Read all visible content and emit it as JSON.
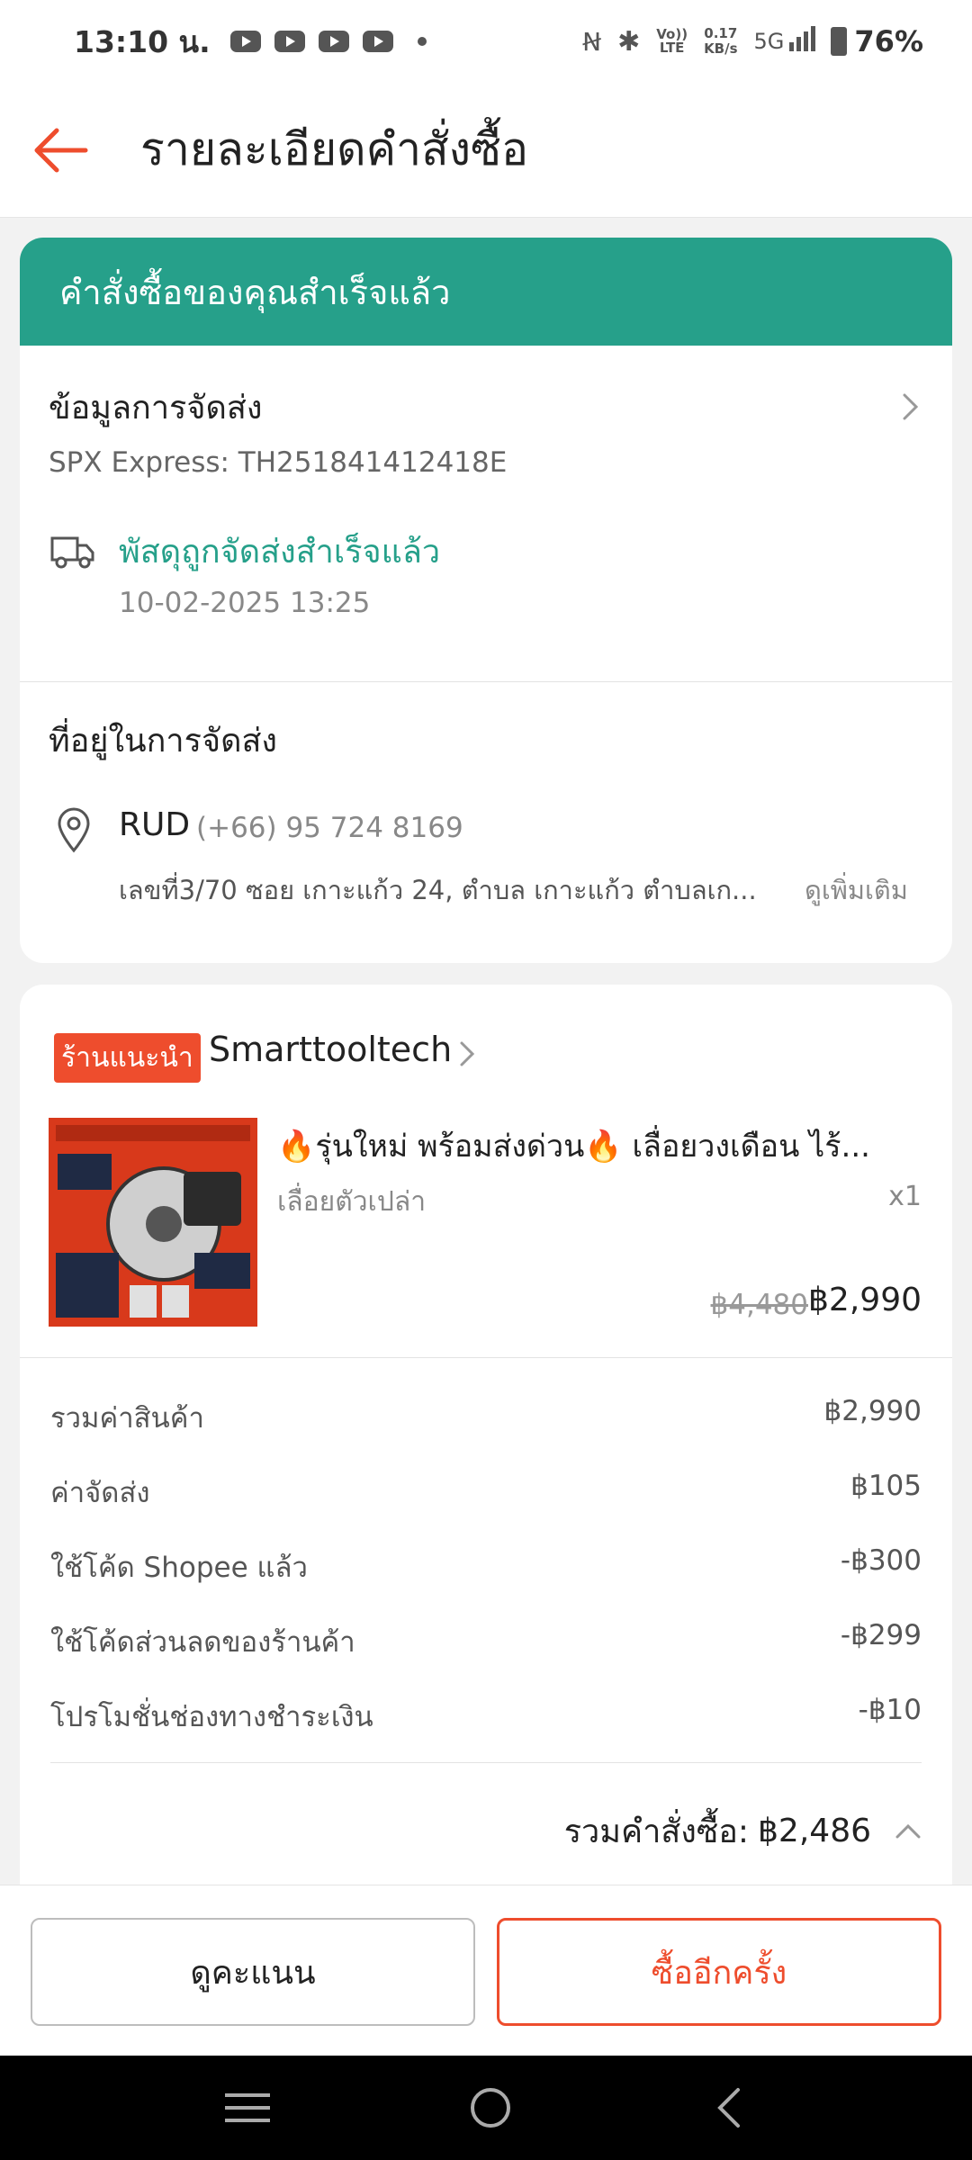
{
  "status_bar": {
    "time": "13:10 น.",
    "network_speed_top": "0.17",
    "network_speed_unit": "KB/s",
    "network_type": "5G",
    "battery": "76%"
  },
  "header": {
    "title": "รายละเอียดคำสั่งซื้อ"
  },
  "order_status": {
    "banner": "คำสั่งซื้อของคุณสำเร็จแล้ว"
  },
  "shipping": {
    "title": "ข้อมูลการจัดส่ง",
    "carrier_tracking": "SPX Express: TH251841412418E",
    "status": "พัสดุถูกจัดส่งสำเร็จแล้ว",
    "timestamp": "10-02-2025 13:25"
  },
  "address": {
    "title": "ที่อยู่ในการจัดส่ง",
    "name": "RUD",
    "phone": "(+66) 95 724 8169",
    "line": "เลขที่3/70 ซอย เกาะแก้ว 24, ตำบล เกาะแก้ว ตำบลเก...",
    "see_more": "ดูเพิ่มเติม"
  },
  "shop": {
    "badge": "ร้านแนะนำ",
    "name": "Smarttooltech"
  },
  "product": {
    "title": "🔥รุ่นใหม่ พร้อมส่งด่วน🔥 เลื่อยวงเดือน ไร้...",
    "variant": "เลื่อยตัวเปล่า",
    "quantity": "x1",
    "original_price": "฿4,480",
    "price": "฿2,990"
  },
  "summary": {
    "rows": [
      {
        "label": "รวมค่าสินค้า",
        "value": "฿2,990"
      },
      {
        "label": "ค่าจัดส่ง",
        "value": "฿105"
      },
      {
        "label": "ใช้โค้ด Shopee แล้ว",
        "value": "-฿300"
      },
      {
        "label": "ใช้โค้ดส่วนลดของร้านค้า",
        "value": "-฿299"
      },
      {
        "label": "โปรโมชั่นช่องทางชำระเงิน",
        "value": "-฿10"
      }
    ],
    "total_label": "รวมคำสั่งซื้อ:",
    "total_value": "฿2,486"
  },
  "actions": {
    "rate_label": "ดูคะแนน",
    "buy_again_label": "ซื้ออีกครั้ง"
  },
  "colors": {
    "accent": "#ee4d2d",
    "success_green": "#26a08a",
    "banner_green": "#26a08a"
  },
  "icons": [
    "back-arrow-icon",
    "chevron-right-icon",
    "truck-icon",
    "location-pin-icon",
    "chevron-up-icon",
    "menu-icon",
    "home-icon",
    "back-icon"
  ]
}
